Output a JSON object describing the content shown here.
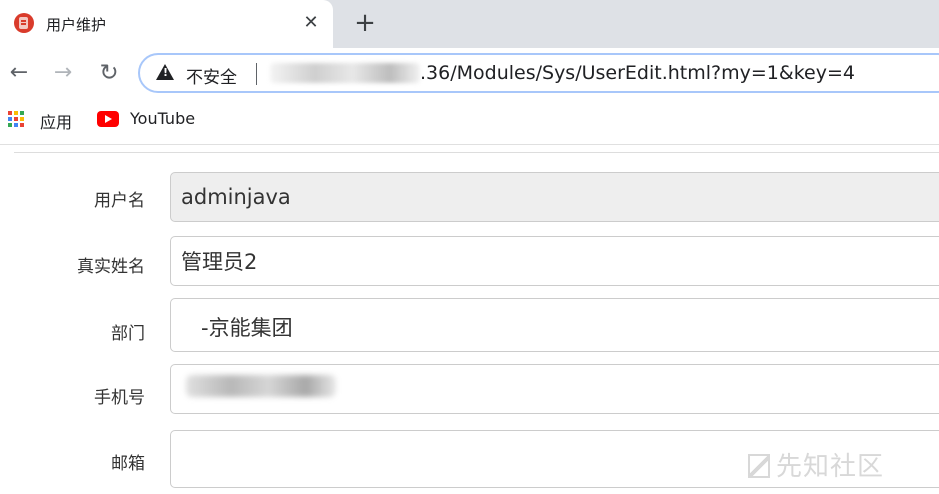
{
  "browser": {
    "tab": {
      "title": "用户维护",
      "close_glyph": "✕"
    },
    "new_tab_glyph": "+",
    "toolbar": {
      "back_glyph": "←",
      "forward_glyph": "→",
      "reload_glyph": "↻",
      "security_label": "不安全",
      "url_visible": ".36/Modules/Sys/UserEdit.html?my=1&key=4"
    },
    "bookmarks": [
      {
        "label": "应用",
        "icon": "apps-grid-icon"
      },
      {
        "label": "YouTube",
        "icon": "youtube-icon"
      }
    ],
    "colors": {
      "tabstrip_bg": "#dee1e6",
      "omnibox_border": "#a8c7fa",
      "youtube_red": "#ff0000",
      "favicon_red": "#d93b2b"
    }
  },
  "form": {
    "username": {
      "label": "用户名",
      "value": "adminjava"
    },
    "realname": {
      "label": "真实姓名",
      "value": "管理员2"
    },
    "department": {
      "label": "部门",
      "value": "-京能集团"
    },
    "phone": {
      "label": "手机号",
      "value": ""
    },
    "email": {
      "label": "邮箱",
      "value": ""
    }
  },
  "watermark": {
    "text": "先知社区"
  }
}
